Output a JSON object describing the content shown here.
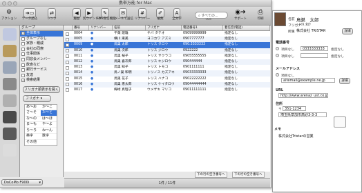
{
  "window": {
    "title": "携帯万能 for Mac"
  },
  "toolbar": {
    "items": [
      {
        "label": "アクション",
        "icon": "action-icon"
      },
      {
        "label": "データ読込",
        "icon": "import-icon"
      },
      {
        "label": "シンク",
        "icon": "sync-icon"
      },
      {
        "label": "履歴",
        "icon": "history-icon"
      },
      {
        "label": "別ウインドウ",
        "icon": "window-icon"
      },
      {
        "label": "SMS受信機能",
        "icon": "sms-icon"
      },
      {
        "label": "メールで送信",
        "icon": "mail-icon"
      },
      {
        "label": "リナンバー",
        "icon": "renumber-icon"
      },
      {
        "label": "編集",
        "icon": "edit-icon"
      },
      {
        "label": "全文字",
        "icon": "text-icon"
      },
      {
        "label": "検索",
        "icon": "search-icon"
      },
      {
        "label": "サポート",
        "icon": "support-icon"
      },
      {
        "label": "印刷",
        "icon": "print-icon"
      }
    ],
    "search_placeholder": "すべての..."
  },
  "groups": {
    "header": "グループ",
    "items": [
      {
        "label": "全体表示",
        "checked": true,
        "selected": true
      },
      {
        "label": "グループなし",
        "checked": false,
        "selected": false
      },
      {
        "label": "家族・親戚",
        "checked": false,
        "selected": false
      },
      {
        "label": "会社の同僚",
        "checked": false,
        "selected": false
      },
      {
        "label": "仕事関係",
        "checked": false,
        "selected": false
      },
      {
        "label": "同窓会メンバー",
        "checked": false,
        "selected": false
      },
      {
        "label": "飲食など",
        "checked": false,
        "selected": false
      },
      {
        "label": "銀行サービス",
        "checked": false,
        "selected": false
      },
      {
        "label": "友達",
        "checked": false,
        "selected": false
      },
      {
        "label": "検索結果",
        "checked": true,
        "selected": false
      }
    ],
    "kana_button": "フリガナ順表示を開く",
    "kana_select": "フリガナ",
    "kana": [
      "あ〜お",
      "か〜こ",
      "さ〜そ",
      "た〜と",
      "な〜の",
      "は〜ほ",
      "ま〜も",
      "や〜よ",
      "ら〜ろ",
      "わ〜ん",
      "英字",
      "数字",
      "その他",
      ""
    ]
  },
  "list": {
    "columns": [
      "",
      "番号",
      "リナンバー",
      "名前",
      "フリガナ",
      "電話番号1",
      "着信音(電話)"
    ],
    "rows": [
      {
        "num": "0004",
        "mark": "●",
        "name": "千葉 建雄",
        "kana": "チバ タテオ",
        "tel": "09099999999",
        "ring": "指定なし"
      },
      {
        "num": "0005",
        "mark": "●",
        "name": "横川 東美",
        "kana": "ヨコカワ アズミ",
        "tel": "0907777777",
        "ring": "指定なし"
      },
      {
        "num": "0009",
        "mark": "●",
        "name": "鳥巣 太郎",
        "kana": "トリス タロウ",
        "tel": "090.3333333",
        "ring": "指定なし"
      },
      {
        "num": "0010",
        "mark": "●",
        "name": "鳥巣 次郎",
        "kana": "トリス ジロウ",
        "tel": "0922222",
        "ring": "指定なし"
      },
      {
        "num": "0011",
        "mark": "●",
        "name": "鳥巣 桜子",
        "kana": "トリス サクラコ",
        "tel": "09055555555",
        "ring": "指定なし"
      },
      {
        "num": "0012",
        "mark": "●",
        "name": "鳥巣 喜次郎",
        "kana": "トリス キジロウ",
        "tel": "090444444",
        "ring": "指定なし"
      },
      {
        "num": "0013",
        "mark": "●",
        "name": "鳥巣 知子",
        "kana": "トリス トモコ",
        "tel": "0901111111",
        "ring": "指定なし"
      },
      {
        "num": "0014",
        "mark": "●",
        "name": "鳥ノ巣 和明",
        "kana": "トリノス カズアキ",
        "tel": "09033333333",
        "ring": "指定なし"
      },
      {
        "num": "0015",
        "mark": "●",
        "name": "鳥巣 花子",
        "kana": "トリス ハナコ",
        "tel": "09022222222",
        "ring": "指定なし"
      },
      {
        "num": "0016",
        "mark": "●",
        "name": "鳥巣 恵太郎",
        "kana": "トリス ケイタロウ",
        "tel": "09044444444",
        "ring": "指定なし"
      },
      {
        "num": "0017",
        "mark": "●",
        "name": "梅崎 真理子",
        "kana": "ウメザキ マリコ",
        "tel": "09011111111",
        "ring": "指定なし"
      }
    ],
    "selected_index": 2
  },
  "nav": {
    "prev": "下の行の空き番号へ",
    "next": "下の行の空き番号へ"
  },
  "status": {
    "text": "1件 / 11件"
  },
  "bottom_select": {
    "value": "DoCoMo F900i"
  },
  "detail": {
    "name_label": "名前",
    "name": "鳥巣　太郎",
    "kana_label": "フリガナ",
    "kana": "ﾄﾘｽ ﾀﾛｳ",
    "group_label": "所属",
    "group": "株式会社 TRISTAR",
    "group_button": "詳細",
    "phone_section": "電話番号",
    "phone_rows": [
      {
        "label": "項目なし",
        "value": "0333333333",
        "extra": "指定なし"
      },
      {
        "label": "項目なし",
        "value": "",
        "extra": "指定なし"
      }
    ],
    "mail_section": "メールアドレス",
    "mail_label": "項目なし",
    "mail_value": "aitemail@example.ne.jp",
    "mail_button": "詳細",
    "url_section": "URL",
    "url_value": "http://www.arenaz_ust.co.jp",
    "address_section": "住所",
    "postal": "351-1234",
    "address": "埼玉県草加市高砂3-3-3",
    "memo_section": "メモ",
    "memo": "株式会社Tristarの営業"
  },
  "colors": {
    "selection": "#3875d7",
    "photo": "#6b4a33"
  }
}
